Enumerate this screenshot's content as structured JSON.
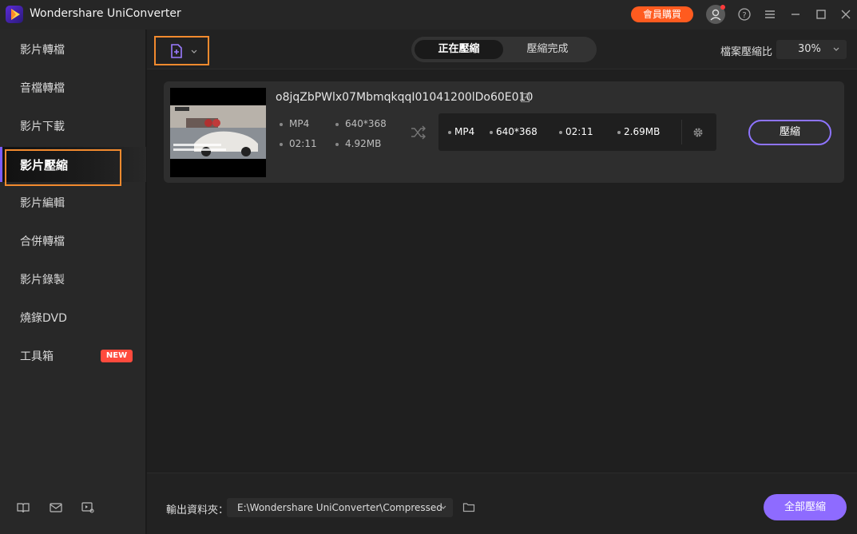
{
  "app": {
    "title": "Wondershare UniConverter",
    "member_button": "會員購買"
  },
  "sidebar": {
    "items": [
      {
        "label": "影片轉檔"
      },
      {
        "label": "音檔轉檔"
      },
      {
        "label": "影片下載"
      },
      {
        "label": "影片壓縮"
      },
      {
        "label": "影片編輯"
      },
      {
        "label": "合併轉檔"
      },
      {
        "label": "影片錄製"
      },
      {
        "label": "燒錄DVD"
      },
      {
        "label": "工具箱"
      }
    ],
    "active_index": 3,
    "new_badge": "NEW"
  },
  "toolbar": {
    "tabs": [
      {
        "label": "正在壓縮"
      },
      {
        "label": "壓縮完成"
      }
    ],
    "ratio_label": "檔案壓縮比",
    "ratio_value": "30%"
  },
  "file": {
    "name": "o8jqZbPWlx07MbmqkqqI01041200lDo60E010",
    "source": {
      "format": "MP4",
      "resolution": "640*368",
      "duration": "02:11",
      "size": "4.92MB"
    },
    "target": {
      "format": "MP4",
      "resolution": "640*368",
      "duration": "02:11",
      "size": "2.69MB"
    },
    "compress_button": "壓縮"
  },
  "footer": {
    "output_label": "輸出資料夾：",
    "output_path": "E:\\Wondershare UniConverter\\Compressed",
    "compress_all_button": "全部壓縮"
  },
  "colors": {
    "accent": "#8e6bff",
    "highlight_box": "#f28a2e",
    "member": "#ff5b1f",
    "new_badge": "#ff4a3d"
  }
}
